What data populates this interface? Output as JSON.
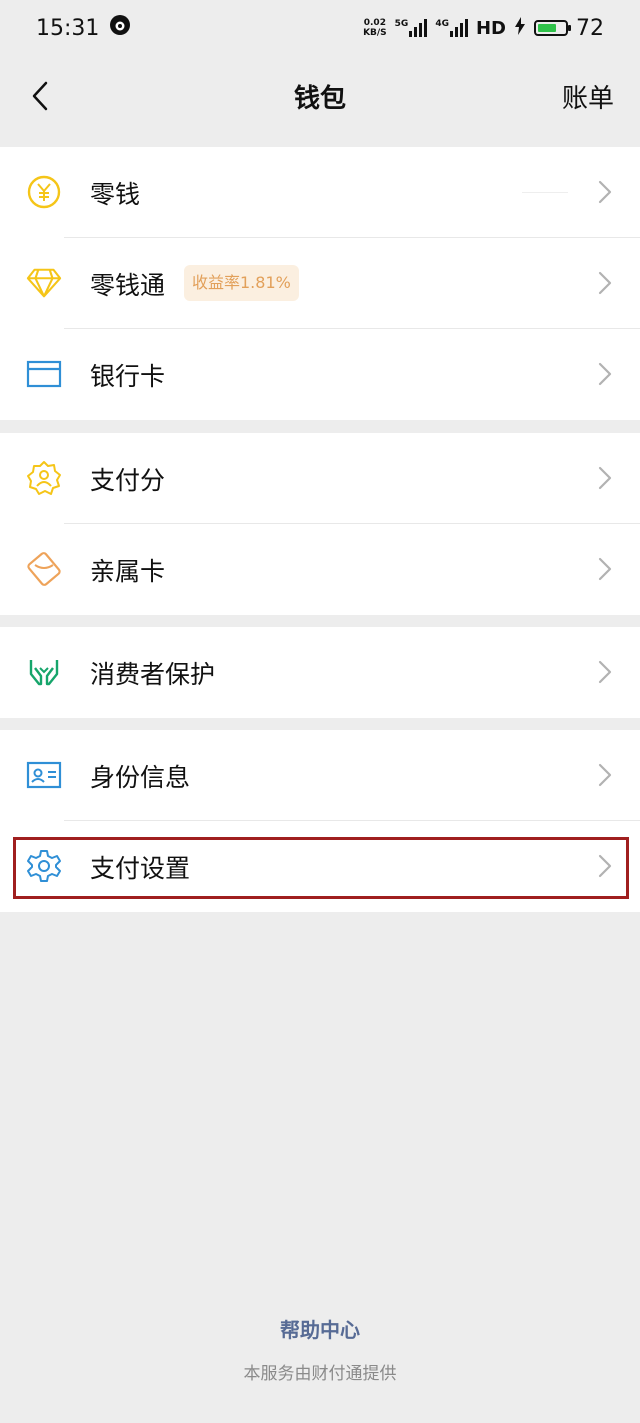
{
  "status_bar": {
    "time": "15:31",
    "net_speed_value": "0.02",
    "net_speed_unit": "KB/S",
    "sig1_label": "5G",
    "sig2_label": "4G",
    "hd_label": "HD",
    "battery": "72"
  },
  "nav": {
    "title": "钱包",
    "right_label": "账单"
  },
  "groups": [
    {
      "items": [
        {
          "label": "零钱",
          "icon": "yuan-coin-icon"
        },
        {
          "label": "零钱通",
          "icon": "diamond-icon",
          "badge": "收益率1.81%"
        },
        {
          "label": "银行卡",
          "icon": "bank-card-icon"
        }
      ]
    },
    {
      "items": [
        {
          "label": "支付分",
          "icon": "pay-score-badge-icon"
        },
        {
          "label": "亲属卡",
          "icon": "family-card-icon"
        }
      ]
    },
    {
      "items": [
        {
          "label": "消费者保护",
          "icon": "hands-protect-icon"
        }
      ]
    },
    {
      "items": [
        {
          "label": "身份信息",
          "icon": "id-card-icon"
        },
        {
          "label": "支付设置",
          "icon": "gear-icon"
        }
      ]
    }
  ],
  "footer": {
    "help": "帮助中心",
    "provider": "本服务由财付通提供"
  },
  "colors": {
    "background": "#ededed",
    "link": "#576b95",
    "badge_bg": "#fbefe0",
    "badge_text": "#e2a05a",
    "highlight": "#a01f1f",
    "gold": "#f5c518",
    "blue": "#2f8fd6",
    "green": "#16a56b"
  }
}
